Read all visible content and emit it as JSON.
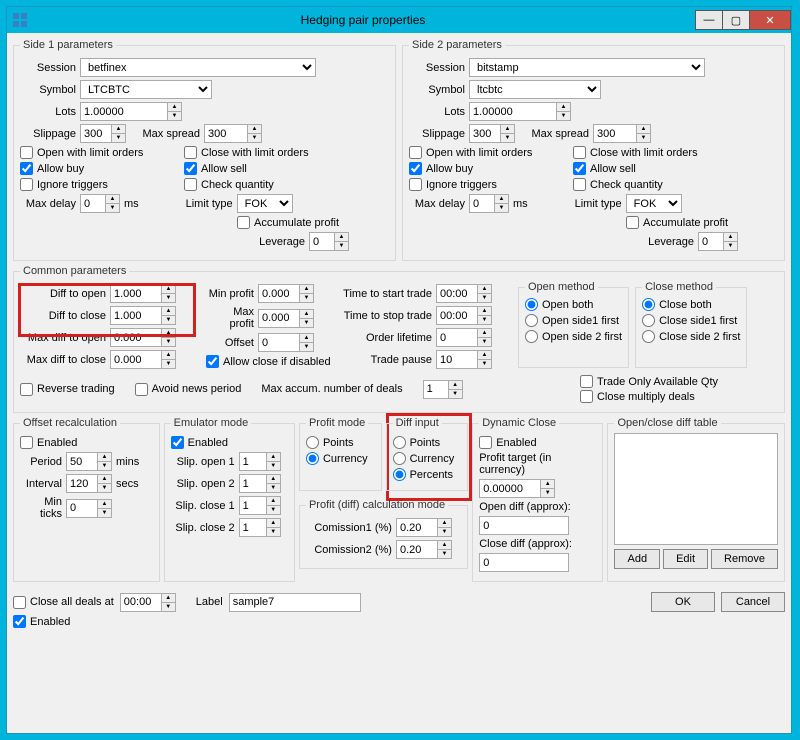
{
  "window": {
    "title": "Hedging pair properties"
  },
  "side1": {
    "legend": "Side 1 parameters",
    "session_lbl": "Session",
    "session": "betfinex",
    "symbol_lbl": "Symbol",
    "symbol": "LTCBTC",
    "lots_lbl": "Lots",
    "lots": "1.00000",
    "slippage_lbl": "Slippage",
    "slippage": "300",
    "maxspread_lbl": "Max spread",
    "maxspread": "300",
    "open_limit": "Open with limit orders",
    "close_limit": "Close with limit orders",
    "allow_buy": "Allow buy",
    "allow_sell": "Allow sell",
    "ignore_triggers": "Ignore triggers",
    "check_qty": "Check quantity",
    "maxdelay_lbl": "Max delay",
    "maxdelay": "0",
    "ms": "ms",
    "limittype_lbl": "Limit type",
    "limittype": "FOK",
    "accum": "Accumulate profit",
    "leverage_lbl": "Leverage",
    "leverage": "0"
  },
  "side2": {
    "legend": "Side 2 parameters",
    "session_lbl": "Session",
    "session": "bitstamp",
    "symbol_lbl": "Symbol",
    "symbol": "ltcbtc",
    "lots_lbl": "Lots",
    "lots": "1.00000",
    "slippage_lbl": "Slippage",
    "slippage": "300",
    "maxspread_lbl": "Max spread",
    "maxspread": "300",
    "open_limit": "Open with limit orders",
    "close_limit": "Close with limit orders",
    "allow_buy": "Allow buy",
    "allow_sell": "Allow sell",
    "ignore_triggers": "Ignore triggers",
    "check_qty": "Check quantity",
    "maxdelay_lbl": "Max delay",
    "maxdelay": "0",
    "ms": "ms",
    "limittype_lbl": "Limit type",
    "limittype": "FOK",
    "accum": "Accumulate profit",
    "leverage_lbl": "Leverage",
    "leverage": "0"
  },
  "common": {
    "legend": "Common parameters",
    "diff_open_lbl": "Diff to open",
    "diff_open": "1.000",
    "diff_close_lbl": "Diff to close",
    "diff_close": "1.000",
    "max_diff_open_lbl": "Max diff to open",
    "max_diff_open": "0.000",
    "max_diff_close_lbl": "Max diff to close",
    "max_diff_close": "0.000",
    "min_profit_lbl": "Min profit",
    "min_profit": "0.000",
    "max_profit_lbl": "Max profit",
    "max_profit": "0.000",
    "offset_lbl": "Offset",
    "offset": "0",
    "allow_close_disabled": "Allow close if disabled",
    "time_start_lbl": "Time to start trade",
    "time_start": "00:00",
    "time_stop_lbl": "Time to stop trade",
    "time_stop": "00:00",
    "order_life_lbl": "Order lifetime",
    "order_life": "0",
    "trade_pause_lbl": "Trade pause",
    "trade_pause": "10",
    "open_method_lbl": "Open method",
    "open_both": "Open both",
    "open_s1": "Open side1 first",
    "open_s2": "Open side 2 first",
    "close_method_lbl": "Close method",
    "close_both": "Close both",
    "close_s1": "Close side1 first",
    "close_s2": "Close side 2 first",
    "trade_only_avail": "Trade Only Available Qty",
    "close_mult": "Close multiply deals",
    "reverse": "Reverse trading",
    "avoid_news": "Avoid news period",
    "max_accum_lbl": "Max accum. number of deals",
    "max_accum": "1"
  },
  "offset": {
    "legend": "Offset recalculation",
    "enabled": "Enabled",
    "period_lbl": "Period",
    "period": "50",
    "mins": "mins",
    "interval_lbl": "Interval",
    "interval": "120",
    "secs": "secs",
    "minticks_lbl": "Min ticks",
    "minticks": "0"
  },
  "emu": {
    "legend": "Emulator mode",
    "enabled": "Enabled",
    "so1_lbl": "Slip. open 1",
    "so1": "1",
    "so2_lbl": "Slip. open 2",
    "so2": "1",
    "sc1_lbl": "Slip. close 1",
    "sc1": "1",
    "sc2_lbl": "Slip. close 2",
    "sc2": "1"
  },
  "profit_mode": {
    "legend": "Profit mode",
    "points": "Points",
    "currency": "Currency"
  },
  "diff_input": {
    "legend": "Diff input",
    "points": "Points",
    "currency": "Currency",
    "percents": "Percents"
  },
  "calc": {
    "legend": "Profit (diff) calculation mode",
    "com1_lbl": "Comission1 (%)",
    "com1": "0.20",
    "com2_lbl": "Comission2 (%)",
    "com2": "0.20"
  },
  "dyn": {
    "legend": "Dynamic Close",
    "enabled": "Enabled",
    "target_lbl": "Profit target (in currency)",
    "target": "0.00000",
    "open_diff_lbl": "Open diff (approx):",
    "open_diff": "0",
    "close_diff_lbl": "Close diff (approx):",
    "close_diff": "0"
  },
  "table": {
    "legend": "Open/close diff table",
    "add": "Add",
    "edit": "Edit",
    "remove": "Remove"
  },
  "footer": {
    "close_all_lbl": "Close all deals at",
    "close_all_time": "00:00",
    "label_lbl": "Label",
    "label_val": "sample7",
    "enabled": "Enabled",
    "ok": "OK",
    "cancel": "Cancel"
  }
}
